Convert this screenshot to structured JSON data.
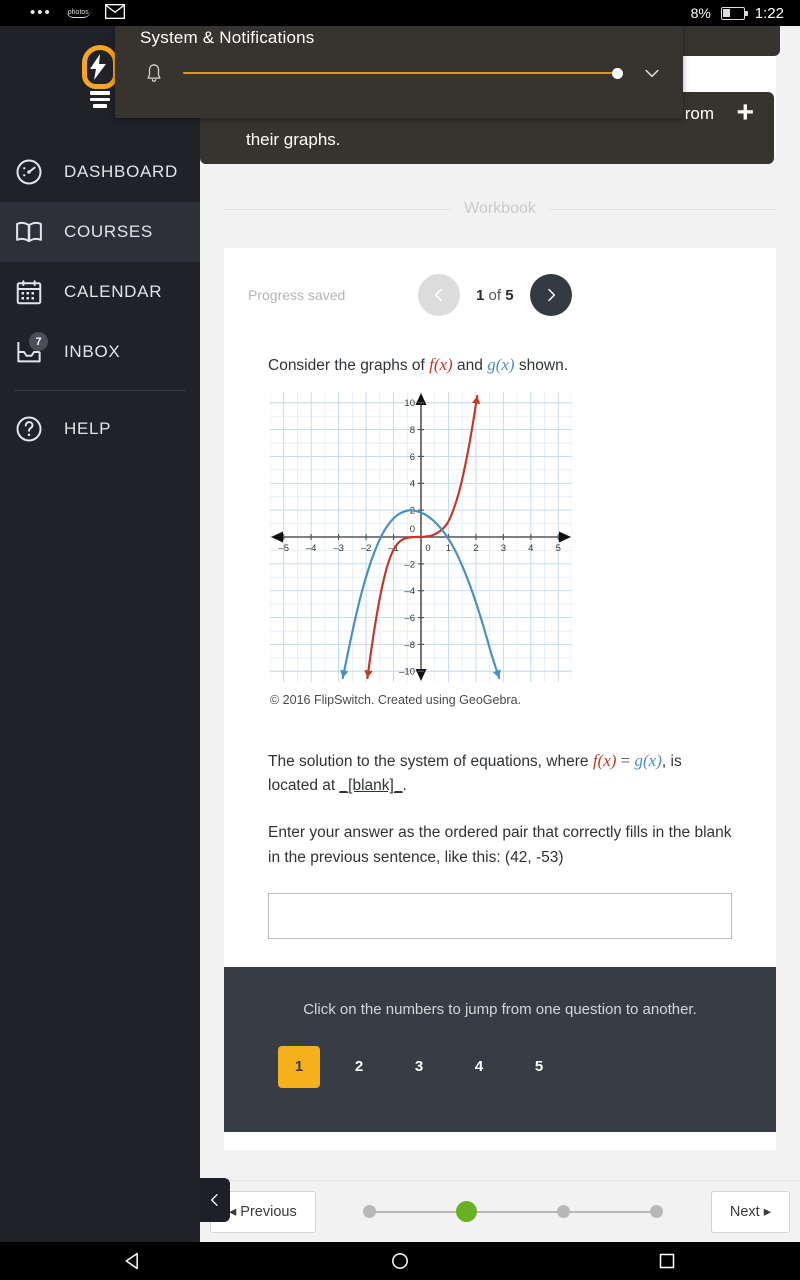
{
  "statusbar": {
    "overflow_icon": "more-dots-icon",
    "photos_label": "photos",
    "mail_icon": "mail-icon",
    "battery_percent": "8%",
    "time": "1:22"
  },
  "notification_shade": {
    "title": "System & Notifications",
    "bell_icon": "bell-icon",
    "slider_value": 100,
    "expand_icon": "chevron-down-icon",
    "accent_color": "#D79B18",
    "background_color": "#37332f"
  },
  "sidebar": {
    "logo_icon": "lightbulb-logo",
    "logo_color": "#F5A623",
    "background_color": "#202228",
    "items": [
      {
        "label": "DASHBOARD",
        "icon": "dashboard-gauge-icon",
        "active": false,
        "badge": ""
      },
      {
        "label": "COURSES",
        "icon": "book-icon",
        "active": true,
        "badge": ""
      },
      {
        "label": "CALENDAR",
        "icon": "calendar-icon",
        "active": false,
        "badge": ""
      },
      {
        "label": "INBOX",
        "icon": "inbox-tray-icon",
        "active": false,
        "badge": "7"
      },
      {
        "label": "HELP",
        "icon": "question-circle-icon",
        "active": false,
        "badge": ""
      }
    ]
  },
  "tooltip": {
    "fragment_right": "rom",
    "second_line": "their graphs.",
    "plus_icon": "plus-icon"
  },
  "workbook": {
    "divider_label": "Workbook",
    "progress_saved": "Progress saved",
    "prev_icon": "chevron-left-icon",
    "next_icon": "chevron-right-icon",
    "page_current": "1",
    "page_of": "of",
    "page_total": "5"
  },
  "question": {
    "prompt_before": "Consider the graphs of ",
    "fx": "f(x)",
    "prompt_and": " and ",
    "gx": "g(x)",
    "prompt_after": " shown.",
    "caption": "© 2016 FlipSwitch. Created using GeoGebra.",
    "statement_part1": "The solution to the system of equations, where ",
    "statement_eq": " = ",
    "statement_part2": ", is located at ",
    "blank_text": "_[blank]_",
    "statement_end": ".",
    "hint": "Enter your answer as the ordered pair that correctly fills in the blank in the previous sentence, like this: (42, -53)",
    "answer_value": "",
    "answer_placeholder": "",
    "fx_color": "#c0392b",
    "gx_color": "#4a90c2"
  },
  "chart_data": {
    "type": "line",
    "title": "",
    "xlabel": "",
    "ylabel": "",
    "xlim": [
      -5.5,
      5.5
    ],
    "ylim": [
      -10.8,
      10.8
    ],
    "xticks": [
      -5,
      -4,
      -3,
      -2,
      -1,
      0,
      1,
      2,
      3,
      4,
      5
    ],
    "yticks": [
      -10,
      -8,
      -6,
      -4,
      -2,
      0,
      2,
      4,
      6,
      8,
      10
    ],
    "grid": true,
    "grid_color": "#c5d9ea",
    "minor_grid": true,
    "legend": "none",
    "series": [
      {
        "name": "f(x)",
        "color": "#c0392b",
        "note": "cubic-like increasing curve with flat inflection near the origin",
        "points": [
          [
            -1.95,
            -10.5
          ],
          [
            -1.8,
            -8.2
          ],
          [
            -1.6,
            -5.6
          ],
          [
            -1.4,
            -3.5
          ],
          [
            -1.2,
            -1.9
          ],
          [
            -1.0,
            -0.9
          ],
          [
            -0.8,
            -0.35
          ],
          [
            -0.6,
            -0.1
          ],
          [
            -0.4,
            -0.02
          ],
          [
            -0.2,
            0.0
          ],
          [
            0.0,
            0.0
          ],
          [
            0.2,
            0.03
          ],
          [
            0.4,
            0.1
          ],
          [
            0.6,
            0.3
          ],
          [
            0.8,
            0.6
          ],
          [
            1.0,
            1.1
          ],
          [
            1.2,
            2.1
          ],
          [
            1.4,
            3.4
          ],
          [
            1.6,
            5.2
          ],
          [
            1.8,
            7.3
          ],
          [
            2.05,
            10.5
          ]
        ]
      },
      {
        "name": "g(x)",
        "color": "#4a90c2",
        "note": "downward parabola with vertex near (-0.3, 2)",
        "points": [
          [
            -2.85,
            -10.5
          ],
          [
            -2.6,
            -8.0
          ],
          [
            -2.3,
            -5.2
          ],
          [
            -2.0,
            -2.9
          ],
          [
            -1.7,
            -1.1
          ],
          [
            -1.4,
            0.3
          ],
          [
            -1.1,
            1.2
          ],
          [
            -0.8,
            1.75
          ],
          [
            -0.5,
            1.98
          ],
          [
            -0.3,
            2.0
          ],
          [
            0.0,
            1.85
          ],
          [
            0.3,
            1.5
          ],
          [
            0.6,
            0.95
          ],
          [
            0.9,
            0.2
          ],
          [
            1.2,
            -0.8
          ],
          [
            1.5,
            -2.1
          ],
          [
            1.9,
            -4.2
          ],
          [
            2.3,
            -6.8
          ],
          [
            2.6,
            -9.0
          ],
          [
            2.85,
            -10.5
          ]
        ]
      }
    ],
    "intersection": [
      1.0,
      1.1
    ]
  },
  "jump_nav": {
    "instruction": "Click on the numbers to jump from one question to another.",
    "numbers": [
      "1",
      "2",
      "3",
      "4",
      "5"
    ],
    "active_index": 0,
    "active_color": "#F5B01C",
    "background_color": "#383c45"
  },
  "bottom_bar": {
    "collapse_icon": "chevron-left-icon",
    "previous_label": "◂ Previous",
    "next_label": "Next ▸",
    "dots_total": 4,
    "dots_current_index": 1,
    "current_dot_color": "#6ab023"
  },
  "android_navbar": {
    "back_icon": "back-triangle-icon",
    "home_icon": "home-circle-icon",
    "recents_icon": "recents-square-icon"
  }
}
